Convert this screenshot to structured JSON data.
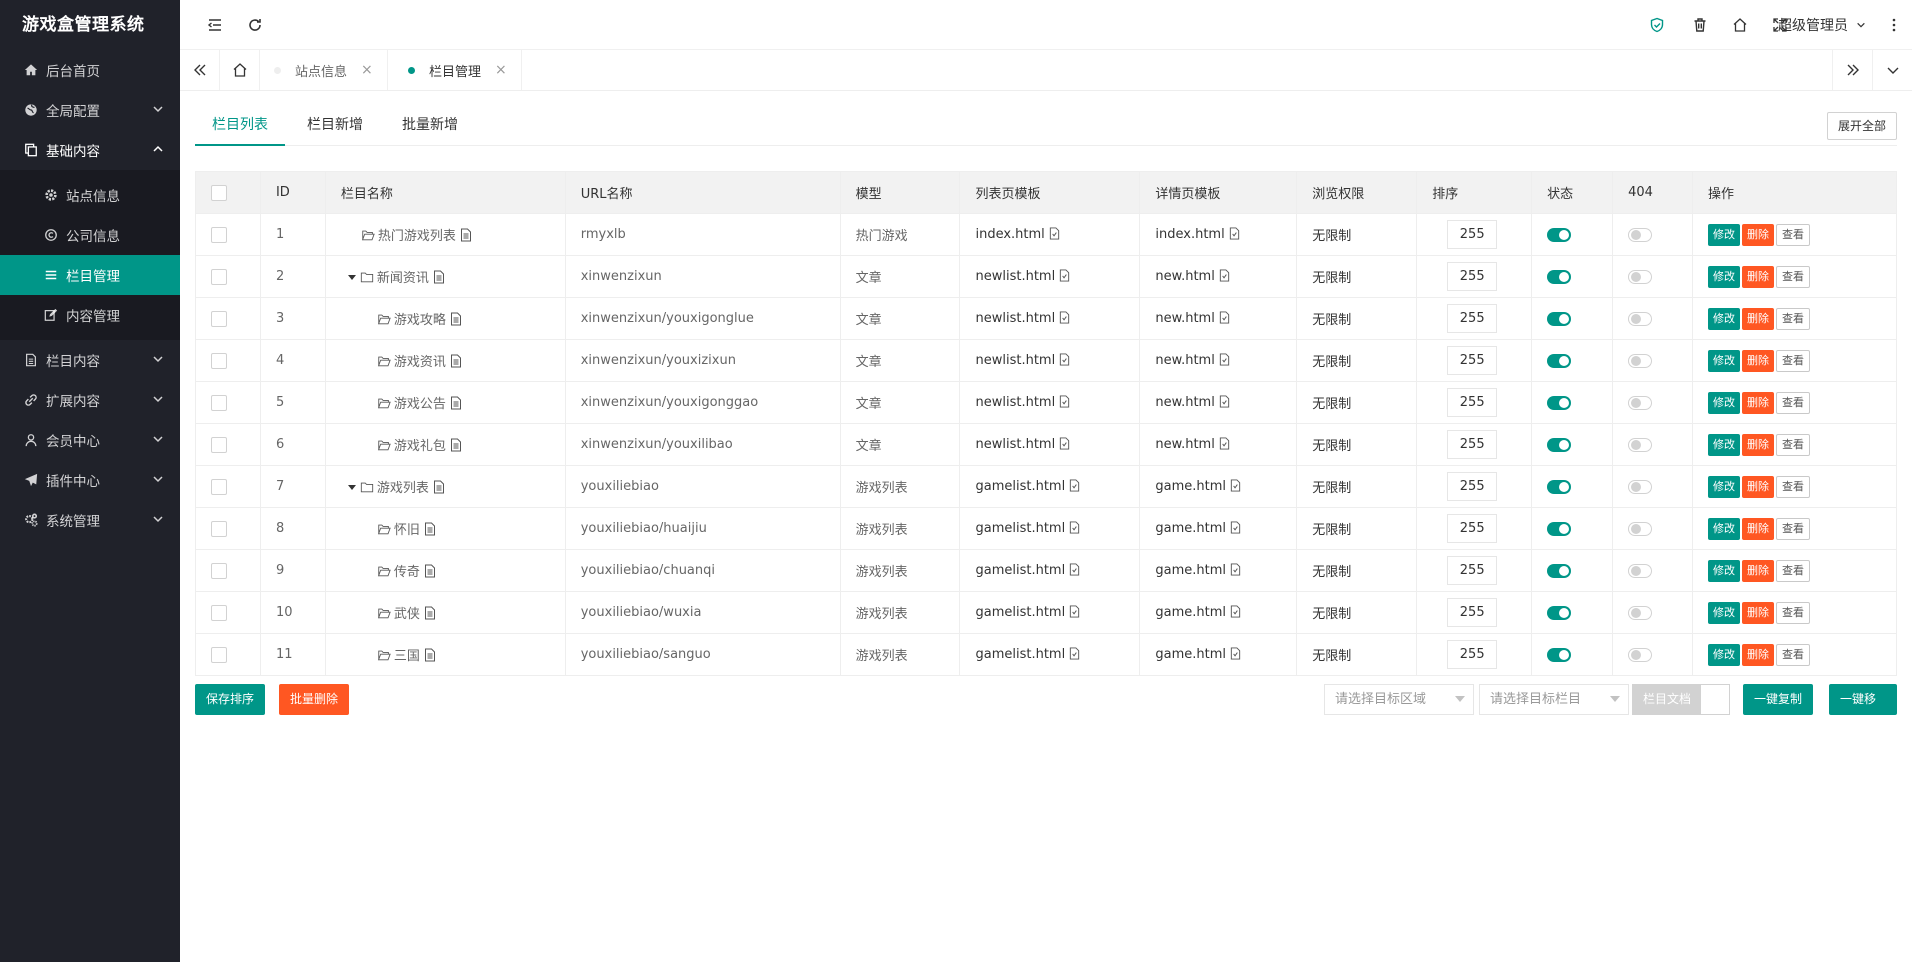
{
  "app": {
    "title": "游戏盒管理系统"
  },
  "sidebar": {
    "items": [
      {
        "label": "后台首页",
        "icon": "home-icon"
      },
      {
        "label": "全局配置",
        "icon": "globe-icon"
      },
      {
        "label": "基础内容",
        "icon": "copy-icon"
      },
      {
        "label": "栏目内容",
        "icon": "file-icon"
      },
      {
        "label": "扩展内容",
        "icon": "link-icon"
      },
      {
        "label": "会员中心",
        "icon": "user-icon"
      },
      {
        "label": "插件中心",
        "icon": "send-icon"
      },
      {
        "label": "系统管理",
        "icon": "gears-icon"
      }
    ],
    "sub": [
      {
        "label": "站点信息",
        "icon": "gear-icon"
      },
      {
        "label": "公司信息",
        "icon": "copyright-icon"
      },
      {
        "label": "栏目管理",
        "icon": "list-icon"
      },
      {
        "label": "内容管理",
        "icon": "edit-icon"
      }
    ]
  },
  "topbar": {
    "user": "超级管理员"
  },
  "tabs": [
    {
      "label": "站点信息"
    },
    {
      "label": "栏目管理"
    }
  ],
  "subtabs": [
    "栏目列表",
    "栏目新增",
    "批量新增"
  ],
  "expand_all": "展开全部",
  "table": {
    "headers": [
      "ID",
      "栏目名称",
      "URL名称",
      "模型",
      "列表页模板",
      "详情页模板",
      "浏览权限",
      "排序",
      "状态",
      "404",
      "操作"
    ],
    "rows": [
      {
        "id": "1",
        "name": "热门游戏列表",
        "url": "rmyxlb",
        "model": "热门游戏",
        "list_tpl": "index.html",
        "detail_tpl": "index.html",
        "perm": "无限制",
        "sort": "255",
        "level": 1,
        "folder": "open",
        "caret": false,
        "status": "on",
        "e404": "off"
      },
      {
        "id": "2",
        "name": "新闻资讯",
        "url": "xinwenzixun",
        "model": "文章",
        "list_tpl": "newlist.html",
        "detail_tpl": "new.html",
        "perm": "无限制",
        "sort": "255",
        "level": 0,
        "folder": "closed",
        "caret": true,
        "status": "on",
        "e404": "off"
      },
      {
        "id": "3",
        "name": "游戏攻略",
        "url": "xinwenzixun/youxigonglue",
        "model": "文章",
        "list_tpl": "newlist.html",
        "detail_tpl": "new.html",
        "perm": "无限制",
        "sort": "255",
        "level": 2,
        "folder": "open",
        "caret": false,
        "status": "on",
        "e404": "off"
      },
      {
        "id": "4",
        "name": "游戏资讯",
        "url": "xinwenzixun/youxizixun",
        "model": "文章",
        "list_tpl": "newlist.html",
        "detail_tpl": "new.html",
        "perm": "无限制",
        "sort": "255",
        "level": 2,
        "folder": "open",
        "caret": false,
        "status": "on",
        "e404": "off"
      },
      {
        "id": "5",
        "name": "游戏公告",
        "url": "xinwenzixun/youxigonggao",
        "model": "文章",
        "list_tpl": "newlist.html",
        "detail_tpl": "new.html",
        "perm": "无限制",
        "sort": "255",
        "level": 2,
        "folder": "open",
        "caret": false,
        "status": "on",
        "e404": "off"
      },
      {
        "id": "6",
        "name": "游戏礼包",
        "url": "xinwenzixun/youxilibao",
        "model": "文章",
        "list_tpl": "newlist.html",
        "detail_tpl": "new.html",
        "perm": "无限制",
        "sort": "255",
        "level": 2,
        "folder": "open",
        "caret": false,
        "status": "on",
        "e404": "off"
      },
      {
        "id": "7",
        "name": "游戏列表",
        "url": "youxiliebiao",
        "model": "游戏列表",
        "list_tpl": "gamelist.html",
        "detail_tpl": "game.html",
        "perm": "无限制",
        "sort": "255",
        "level": 0,
        "folder": "closed",
        "caret": true,
        "status": "on",
        "e404": "off"
      },
      {
        "id": "8",
        "name": "怀旧",
        "url": "youxiliebiao/huaijiu",
        "model": "游戏列表",
        "list_tpl": "gamelist.html",
        "detail_tpl": "game.html",
        "perm": "无限制",
        "sort": "255",
        "level": 2,
        "folder": "open",
        "caret": false,
        "status": "on",
        "e404": "off"
      },
      {
        "id": "9",
        "name": "传奇",
        "url": "youxiliebiao/chuanqi",
        "model": "游戏列表",
        "list_tpl": "gamelist.html",
        "detail_tpl": "game.html",
        "perm": "无限制",
        "sort": "255",
        "level": 2,
        "folder": "open",
        "caret": false,
        "status": "on",
        "e404": "off"
      },
      {
        "id": "10",
        "name": "武侠",
        "url": "youxiliebiao/wuxia",
        "model": "游戏列表",
        "list_tpl": "gamelist.html",
        "detail_tpl": "game.html",
        "perm": "无限制",
        "sort": "255",
        "level": 2,
        "folder": "open",
        "caret": false,
        "status": "on",
        "e404": "off"
      },
      {
        "id": "11",
        "name": "三国",
        "url": "youxiliebiao/sanguo",
        "model": "游戏列表",
        "list_tpl": "gamelist.html",
        "detail_tpl": "game.html",
        "perm": "无限制",
        "sort": "255",
        "level": 2,
        "folder": "open",
        "caret": false,
        "status": "on",
        "e404": "off"
      }
    ],
    "actions": {
      "edit": "修改",
      "delete": "删除",
      "view": "查看"
    }
  },
  "footer": {
    "save_sort": "保存排序",
    "batch_delete": "批量删除",
    "target_area_placeholder": "请选择目标区域",
    "target_column_placeholder": "请选择目标栏目",
    "doc_toggle": "栏目文档",
    "copy": "一键复制",
    "move": "一键移动"
  },
  "colors": {
    "accent": "#009688",
    "danger": "#ff5722",
    "sidebar_bg": "#20222a"
  }
}
